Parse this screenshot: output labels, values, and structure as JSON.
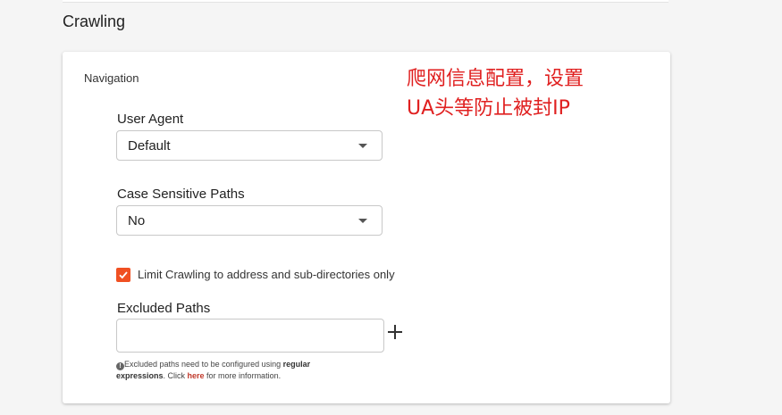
{
  "section": {
    "title": "Crawling"
  },
  "card": {
    "label": "Navigation"
  },
  "annotation": {
    "line1": "爬网信息配置，设置",
    "line2": "UA头等防止被封IP",
    "color": "#e02020"
  },
  "user_agent": {
    "label": "User Agent",
    "value": "Default"
  },
  "case_sensitive": {
    "label": "Case Sensitive Paths",
    "value": "No"
  },
  "limit_crawling": {
    "label": "Limit Crawling to address and sub-directories only",
    "checked": true,
    "color": "#f05022"
  },
  "excluded_paths": {
    "label": "Excluded Paths",
    "value": "",
    "help_prefix": "Excluded paths need to be configured using ",
    "help_bold": "regular expressions",
    "help_mid": ". Click ",
    "help_link": "here",
    "help_suffix": " for more information."
  },
  "icons": {
    "caret": "chevron-down-icon",
    "check": "check-icon",
    "plus": "plus-icon",
    "info": "info-icon"
  }
}
